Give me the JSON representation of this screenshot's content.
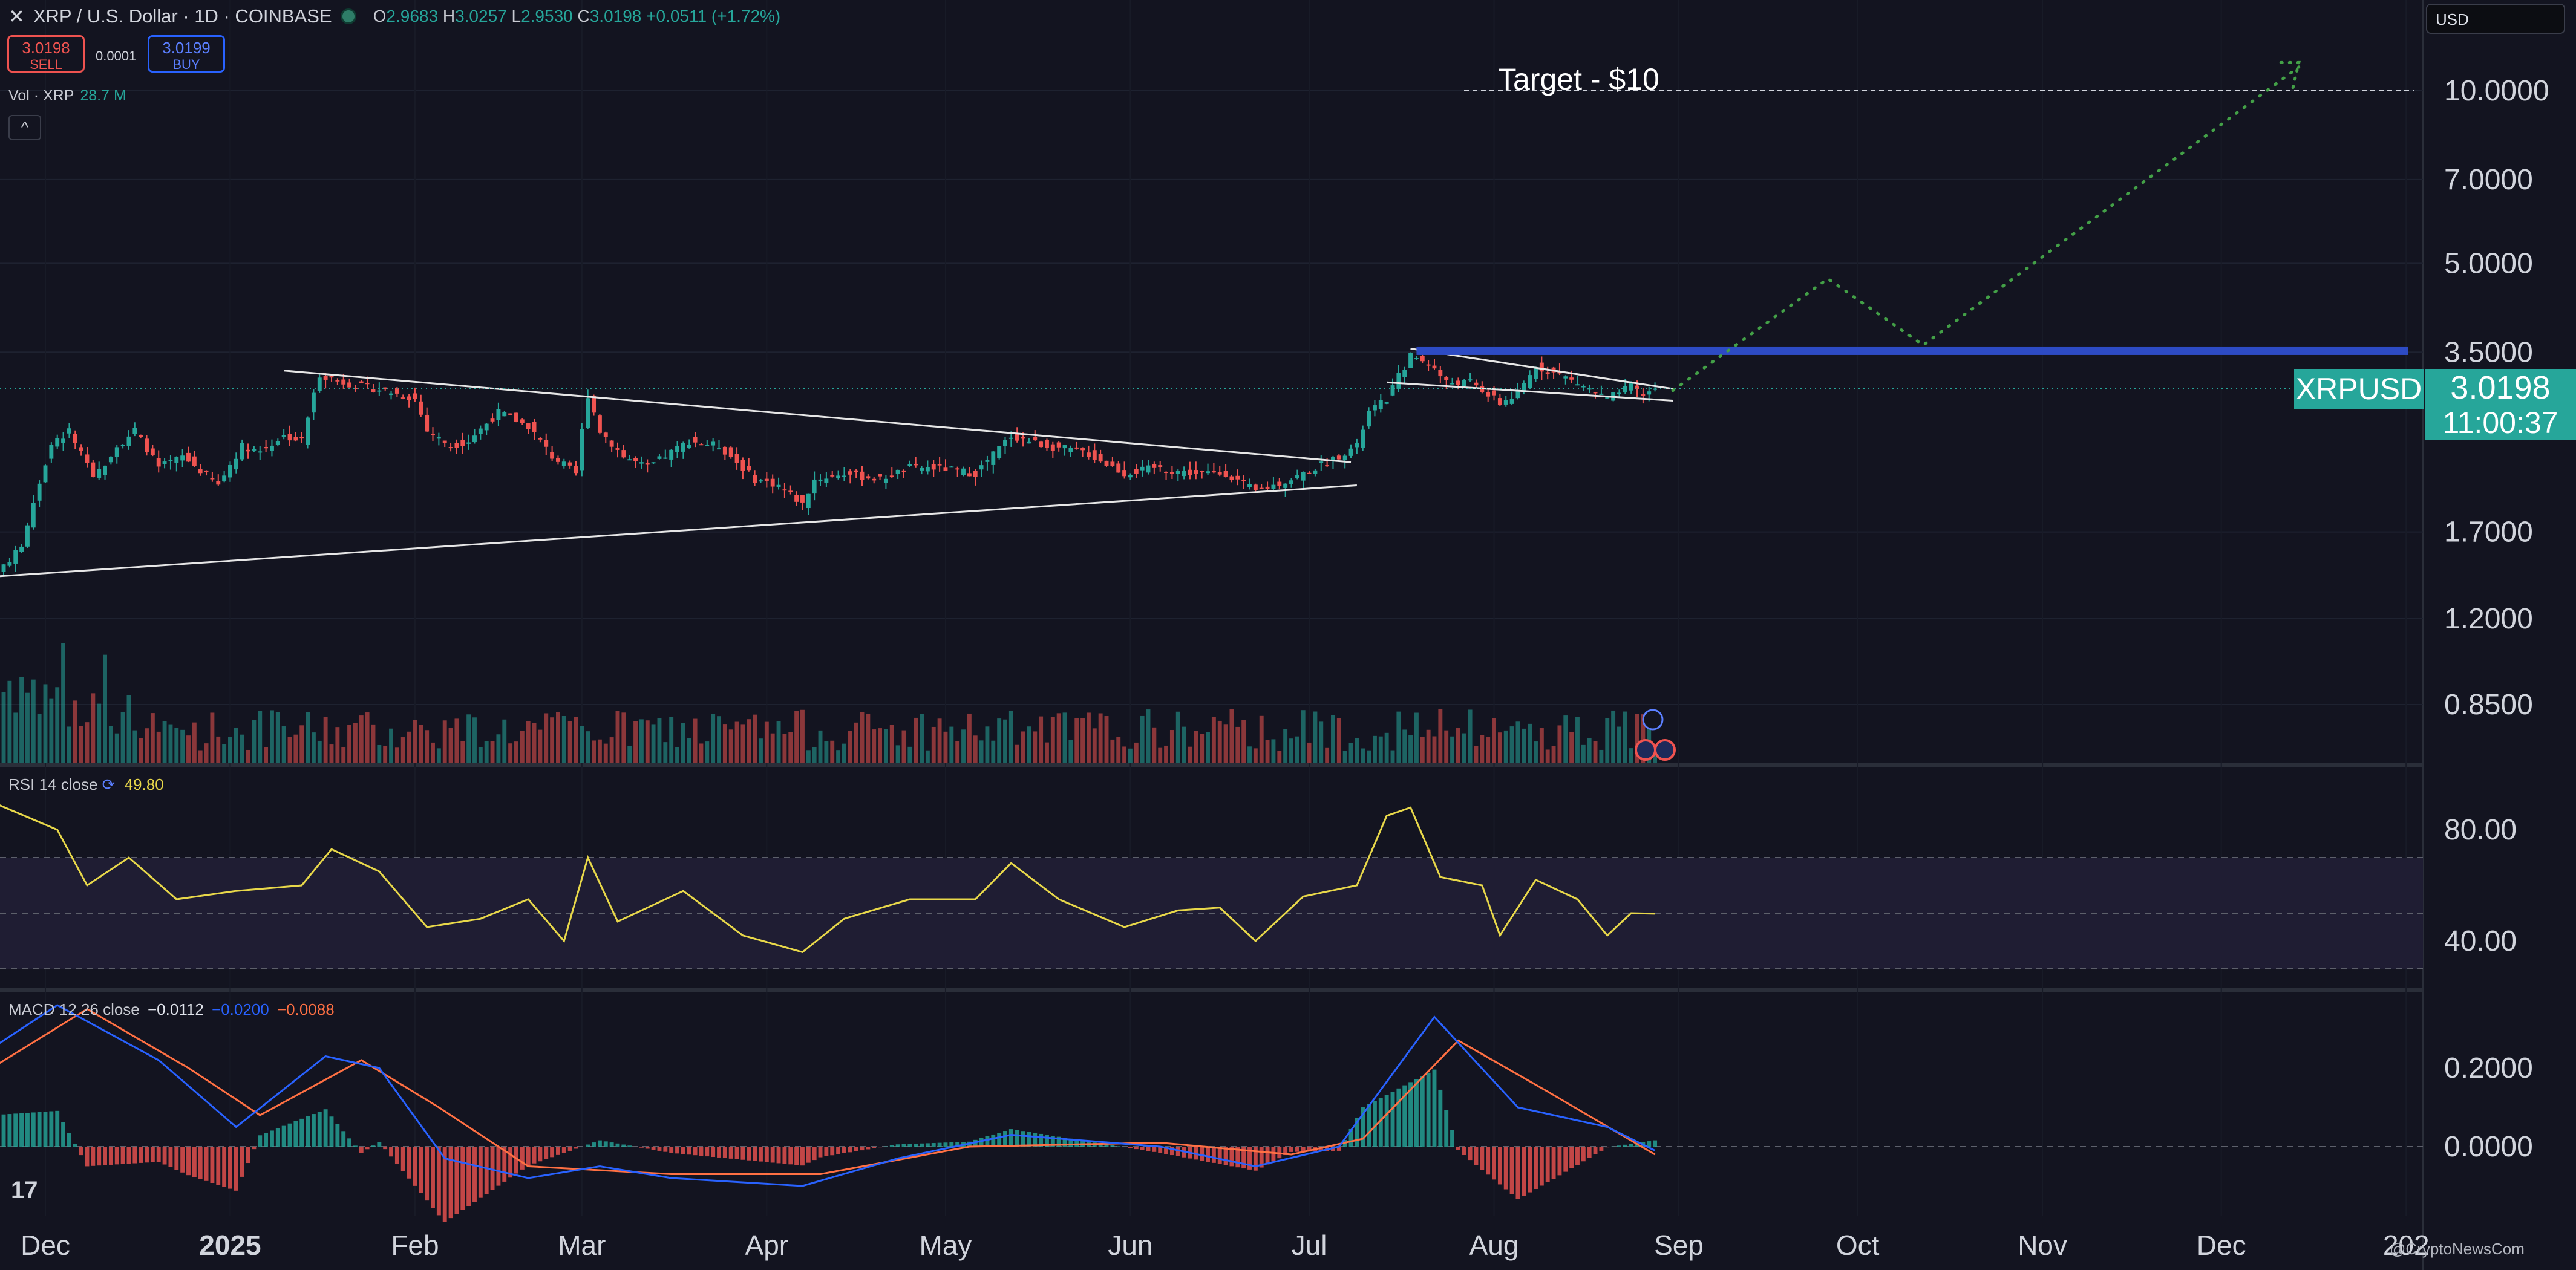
{
  "header": {
    "symbol": "XRP / U.S. Dollar · 1D · COINBASE",
    "open_label": "O",
    "open": "2.9683",
    "high_label": "H",
    "high": "3.0257",
    "low_label": "L",
    "low": "2.9530",
    "close_label": "C",
    "close": "3.0198",
    "change": "+0.0511 (+1.72%)"
  },
  "order": {
    "sell_price": "3.0198",
    "sell_label": "SELL",
    "buy_price": "3.0199",
    "buy_label": "BUY",
    "spread": "0.0001"
  },
  "volume": {
    "label": "Vol · XRP",
    "value": "28.7 M"
  },
  "currency": "USD",
  "annotation": {
    "target": "Target - $10"
  },
  "price": {
    "ticker": "XRPUSD",
    "last": "3.0198",
    "countdown": "11:00:37"
  },
  "rsi": {
    "label": "RSI 14 close",
    "value": "49.80"
  },
  "macd": {
    "label": "MACD 12 26 close",
    "macd": "−0.0112",
    "signal": "−0.0200",
    "hist": "−0.0088"
  },
  "credit": "@CryptoNewsCom",
  "colors": {
    "up": "#26a69a",
    "down": "#ef5350",
    "rsi": "#e8d84a",
    "macd": "#2962ff",
    "signal": "#ff7043",
    "resistance": "#2d4bc4",
    "projection": "#43a047"
  },
  "chart_data": [
    {
      "type": "candlestick",
      "title": "XRP / U.S. Dollar · 1D · COINBASE",
      "y_scale": "log",
      "y_ticks": [
        "0.8500",
        "1.2000",
        "1.7000",
        "3.5000",
        "5.0000",
        "7.0000",
        "10.0000"
      ],
      "x_ticks": [
        "Dec",
        "2025",
        "Feb",
        "Mar",
        "Apr",
        "May",
        "Jun",
        "Jul",
        "Aug",
        "Sep",
        "Oct",
        "Nov",
        "Dec",
        "202"
      ],
      "x_range": [
        "2024-11-22",
        "2026-01-15"
      ],
      "series_close": [
        [
          "2024-11-22",
          1.4
        ],
        [
          "2024-11-27",
          1.6
        ],
        [
          "2024-12-02",
          2.4
        ],
        [
          "2024-12-05",
          2.55
        ],
        [
          "2024-12-09",
          2.1
        ],
        [
          "2024-12-13",
          2.4
        ],
        [
          "2024-12-16",
          2.55
        ],
        [
          "2024-12-20",
          2.2
        ],
        [
          "2024-12-24",
          2.3
        ],
        [
          "2024-12-30",
          2.05
        ],
        [
          "2025-01-03",
          2.4
        ],
        [
          "2025-01-06",
          2.35
        ],
        [
          "2025-01-10",
          2.5
        ],
        [
          "2025-01-13",
          2.45
        ],
        [
          "2025-01-16",
          3.2
        ],
        [
          "2025-01-20",
          3.1
        ],
        [
          "2025-01-23",
          3.05
        ],
        [
          "2025-01-27",
          3.0
        ],
        [
          "2025-02-01",
          2.9
        ],
        [
          "2025-02-03",
          2.55
        ],
        [
          "2025-02-07",
          2.4
        ],
        [
          "2025-02-10",
          2.45
        ],
        [
          "2025-02-15",
          2.75
        ],
        [
          "2025-02-20",
          2.6
        ],
        [
          "2025-02-24",
          2.3
        ],
        [
          "2025-02-28",
          2.15
        ],
        [
          "2025-03-02",
          2.95
        ],
        [
          "2025-03-04",
          2.55
        ],
        [
          "2025-03-08",
          2.3
        ],
        [
          "2025-03-12",
          2.2
        ],
        [
          "2025-03-19",
          2.45
        ],
        [
          "2025-03-24",
          2.4
        ],
        [
          "2025-03-30",
          2.1
        ],
        [
          "2025-04-03",
          2.05
        ],
        [
          "2025-04-07",
          1.9
        ],
        [
          "2025-04-09",
          2.1
        ],
        [
          "2025-04-14",
          2.15
        ],
        [
          "2025-04-20",
          2.1
        ],
        [
          "2025-04-25",
          2.2
        ],
        [
          "2025-04-30",
          2.2
        ],
        [
          "2025-05-06",
          2.15
        ],
        [
          "2025-05-12",
          2.5
        ],
        [
          "2025-05-18",
          2.4
        ],
        [
          "2025-05-24",
          2.35
        ],
        [
          "2025-05-31",
          2.15
        ],
        [
          "2025-06-05",
          2.2
        ],
        [
          "2025-06-12",
          2.15
        ],
        [
          "2025-06-17",
          2.15
        ],
        [
          "2025-06-22",
          2.0
        ],
        [
          "2025-06-28",
          2.1
        ],
        [
          "2025-07-04",
          2.25
        ],
        [
          "2025-07-09",
          2.4
        ],
        [
          "2025-07-11",
          2.75
        ],
        [
          "2025-07-14",
          2.9
        ],
        [
          "2025-07-18",
          3.45
        ],
        [
          "2025-07-21",
          3.35
        ],
        [
          "2025-07-24",
          3.1
        ],
        [
          "2025-07-28",
          3.1
        ],
        [
          "2025-08-02",
          2.85
        ],
        [
          "2025-08-05",
          2.95
        ],
        [
          "2025-08-08",
          3.3
        ],
        [
          "2025-08-12",
          3.2
        ],
        [
          "2025-08-16",
          3.05
        ],
        [
          "2025-08-20",
          2.9
        ],
        [
          "2025-08-24",
          3.05
        ],
        [
          "2025-08-26",
          2.95
        ],
        [
          "2025-08-28",
          3.02
        ]
      ]
    },
    {
      "type": "line",
      "name": "RSI 14 close",
      "y_ticks": [
        "40.00",
        "80.00"
      ],
      "levels": [
        30,
        50,
        70
      ],
      "points": [
        [
          "2024-11-22",
          90
        ],
        [
          "2024-12-03",
          80
        ],
        [
          "2024-12-08",
          60
        ],
        [
          "2024-12-15",
          70
        ],
        [
          "2024-12-23",
          55
        ],
        [
          "2025-01-02",
          58
        ],
        [
          "2025-01-13",
          60
        ],
        [
          "2025-01-18",
          73
        ],
        [
          "2025-01-26",
          65
        ],
        [
          "2025-02-03",
          45
        ],
        [
          "2025-02-12",
          48
        ],
        [
          "2025-02-20",
          55
        ],
        [
          "2025-02-26",
          40
        ],
        [
          "2025-03-02",
          70
        ],
        [
          "2025-03-07",
          47
        ],
        [
          "2025-03-18",
          58
        ],
        [
          "2025-03-28",
          42
        ],
        [
          "2025-04-07",
          36
        ],
        [
          "2025-04-14",
          48
        ],
        [
          "2025-04-25",
          55
        ],
        [
          "2025-05-06",
          55
        ],
        [
          "2025-05-12",
          68
        ],
        [
          "2025-05-20",
          55
        ],
        [
          "2025-05-31",
          45
        ],
        [
          "2025-06-09",
          51
        ],
        [
          "2025-06-16",
          52
        ],
        [
          "2025-06-22",
          40
        ],
        [
          "2025-06-30",
          56
        ],
        [
          "2025-07-09",
          60
        ],
        [
          "2025-07-14",
          85
        ],
        [
          "2025-07-18",
          88
        ],
        [
          "2025-07-23",
          63
        ],
        [
          "2025-07-30",
          60
        ],
        [
          "2025-08-02",
          42
        ],
        [
          "2025-08-08",
          62
        ],
        [
          "2025-08-15",
          55
        ],
        [
          "2025-08-20",
          42
        ],
        [
          "2025-08-24",
          50
        ],
        [
          "2025-08-28",
          49.8
        ]
      ]
    },
    {
      "type": "line",
      "name": "MACD 12 26 close",
      "y_ticks": [
        "0.0000",
        "0.2000"
      ],
      "series": [
        {
          "name": "MACD",
          "points": [
            [
              "2024-11-22",
              0.25
            ],
            [
              "2024-12-03",
              0.36
            ],
            [
              "2024-12-20",
              0.22
            ],
            [
              "2025-01-02",
              0.05
            ],
            [
              "2025-01-17",
              0.23
            ],
            [
              "2025-01-26",
              0.2
            ],
            [
              "2025-02-06",
              -0.03
            ],
            [
              "2025-02-20",
              -0.08
            ],
            [
              "2025-03-04",
              -0.05
            ],
            [
              "2025-03-16",
              -0.08
            ],
            [
              "2025-04-07",
              -0.1
            ],
            [
              "2025-04-23",
              -0.03
            ],
            [
              "2025-05-12",
              0.03
            ],
            [
              "2025-06-06",
              0.0
            ],
            [
              "2025-06-22",
              -0.05
            ],
            [
              "2025-07-06",
              0.0
            ],
            [
              "2025-07-22",
              0.33
            ],
            [
              "2025-08-05",
              0.1
            ],
            [
              "2025-08-20",
              0.05
            ],
            [
              "2025-08-28",
              -0.01
            ]
          ]
        },
        {
          "name": "Signal",
          "points": [
            [
              "2024-11-22",
              0.2
            ],
            [
              "2024-12-08",
              0.35
            ],
            [
              "2024-12-25",
              0.2
            ],
            [
              "2025-01-06",
              0.08
            ],
            [
              "2025-01-23",
              0.22
            ],
            [
              "2025-02-05",
              0.1
            ],
            [
              "2025-02-20",
              -0.05
            ],
            [
              "2025-03-16",
              -0.07
            ],
            [
              "2025-04-10",
              -0.07
            ],
            [
              "2025-05-05",
              0.0
            ],
            [
              "2025-06-06",
              0.01
            ],
            [
              "2025-06-28",
              -0.02
            ],
            [
              "2025-07-10",
              0.02
            ],
            [
              "2025-07-26",
              0.27
            ],
            [
              "2025-08-10",
              0.14
            ],
            [
              "2025-08-28",
              -0.02
            ]
          ]
        }
      ],
      "histogram_range": [
        -0.15,
        0.15
      ]
    }
  ]
}
